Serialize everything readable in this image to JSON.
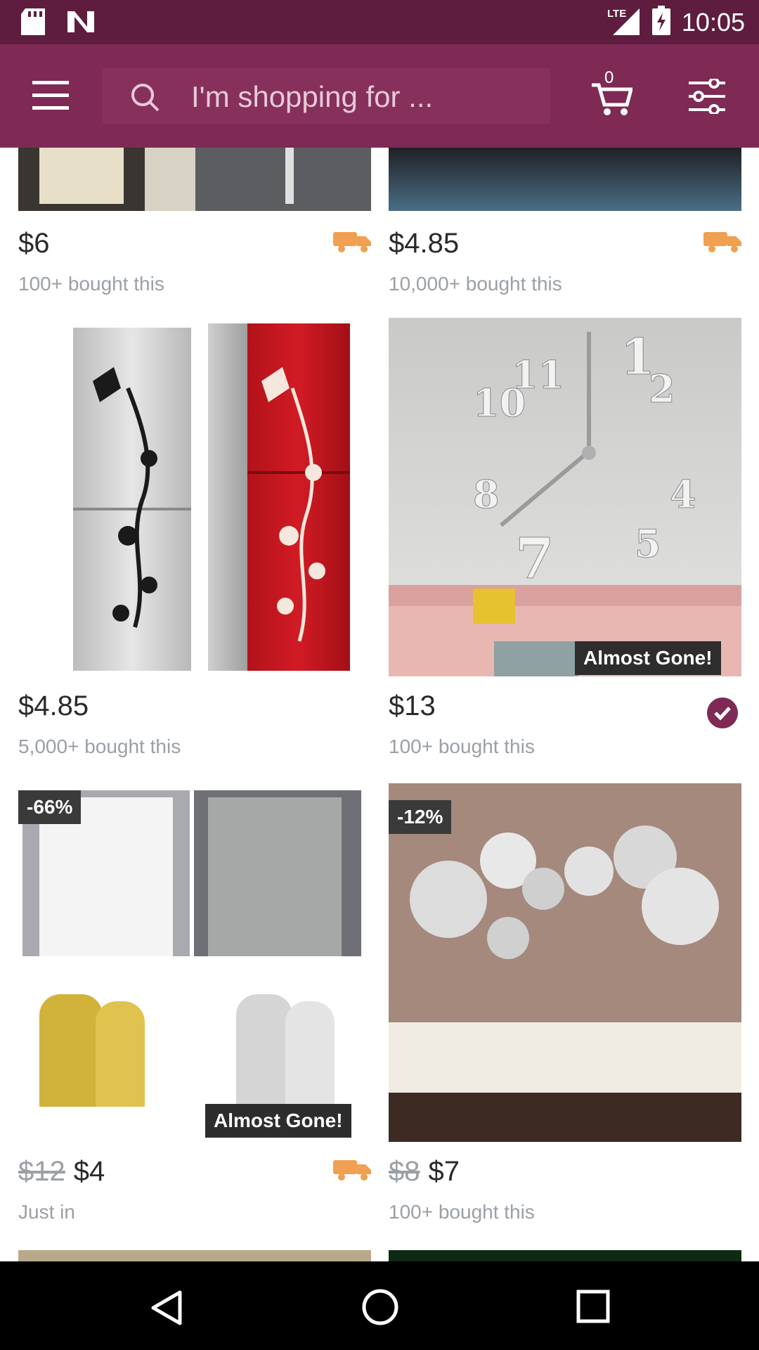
{
  "status_bar": {
    "time": "10:05",
    "network": "LTE",
    "icons": [
      "sd-card-icon",
      "n-notification-icon",
      "signal-icon",
      "battery-charging-icon"
    ]
  },
  "app_bar": {
    "search_placeholder": "I'm shopping for ...",
    "cart_count": "0",
    "icons": [
      "menu-icon",
      "search-icon",
      "cart-icon",
      "filter-icon"
    ]
  },
  "products": [
    {
      "price": "$6",
      "old_price": "",
      "subtitle": "100+ bought this",
      "badge": "",
      "discount": "",
      "shipping_icon": true
    },
    {
      "price": "$4.85",
      "old_price": "",
      "subtitle": "10,000+ bought this",
      "badge": "",
      "discount": "",
      "shipping_icon": true
    },
    {
      "price": "$4.85",
      "old_price": "",
      "subtitle": "5,000+ bought this",
      "badge": "",
      "discount": "",
      "shipping_icon": false
    },
    {
      "price": "$13",
      "old_price": "",
      "subtitle": "100+ bought this",
      "badge": "Almost Gone!",
      "discount": "",
      "verified_icon": true
    },
    {
      "price": "$4",
      "old_price": "$12",
      "subtitle": "Just in",
      "badge": "Almost Gone!",
      "discount": "-66%",
      "shipping_icon": true
    },
    {
      "price": "$7",
      "old_price": "$8",
      "subtitle": "100+ bought this",
      "badge": "",
      "discount": "-12%",
      "shipping_icon": false
    }
  ],
  "colors": {
    "status_bar": "#5e1d3e",
    "app_bar": "#7e2a54",
    "shipping_icon": "#f0a050"
  }
}
